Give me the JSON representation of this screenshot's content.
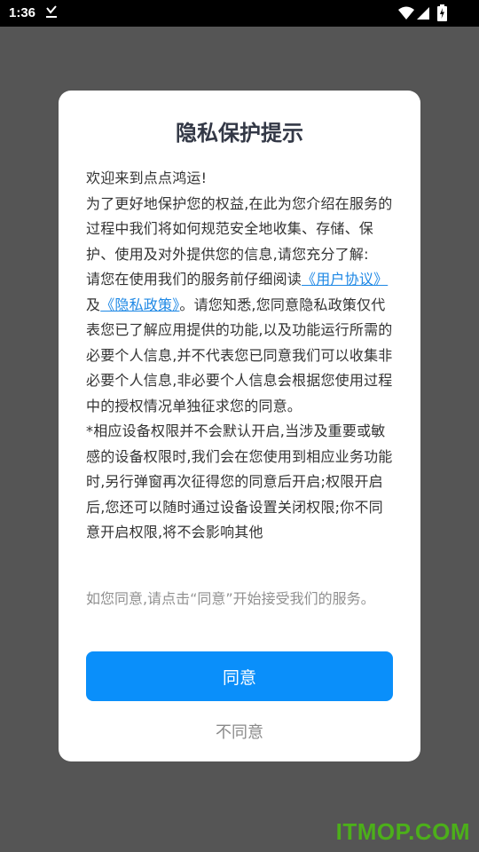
{
  "status_bar": {
    "time": "1:36",
    "icons": [
      "download-done-icon",
      "wifi-icon",
      "signal-icon",
      "battery-charging-icon"
    ]
  },
  "dialog": {
    "title": "隐私保护提示",
    "intro": "欢迎来到点点鸿运!",
    "para1": "为了更好地保护您的权益,在此为您介绍在服务的过程中我们将如何规范安全地收集、存储、保护、使用及对外提供您的信息,请您充分了解:",
    "para2_prefix": "请您在使用我们的服务前仔细阅读",
    "user_agreement_link": "《用户协议》",
    "para2_and": "及",
    "privacy_policy_link": "《隐私政策》",
    "para2_suffix": "。请您知悉,您同意隐私政策仅代表您已了解应用提供的功能,以及功能运行所需的必要个人信息,并不代表您已同意我们可以收集非必要个人信息,非必要个人信息会根据您使用过程中的授权情况单独征求您的同意。",
    "para3": "*相应设备权限并不会默认开启,当涉及重要或敏感的设备权限时,我们会在您使用到相应业务功能时,另行弹窗再次征得您的同意后开启;权限开启后,您还可以随时通过设备设置关闭权限;你不同意开启权限,将不会影响其他",
    "consent_note": "如您同意,请点击“同意”开始接受我们的服务。",
    "agree_label": "同意",
    "disagree_label": "不同意"
  },
  "watermark": "ITMOP.COM",
  "colors": {
    "overlay": "#555555",
    "primary_button": "#0a8ffa",
    "link": "#1e88e5",
    "title": "#333846",
    "watermark": "#4caf1a"
  }
}
